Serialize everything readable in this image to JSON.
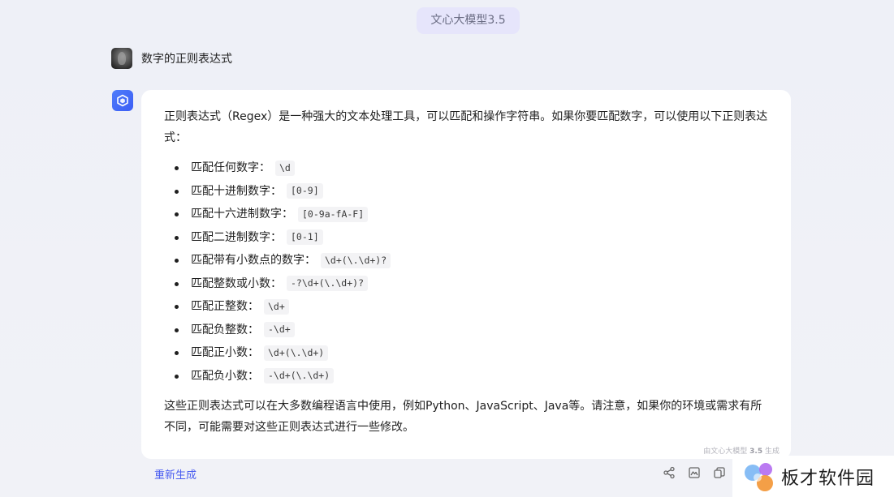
{
  "header": {
    "model_label": "文心大模型3.5"
  },
  "conversation": {
    "user_question": "数字的正则表达式",
    "answer": {
      "intro": "正则表达式（Regex）是一种强大的文本处理工具，可以匹配和操作字符串。如果你要匹配数字，可以使用以下正则表达式：",
      "items": [
        {
          "label": "匹配任何数字：",
          "code": "\\d"
        },
        {
          "label": "匹配十进制数字：",
          "code": "[0-9]"
        },
        {
          "label": "匹配十六进制数字：",
          "code": "[0-9a-fA-F]"
        },
        {
          "label": "匹配二进制数字：",
          "code": "[0-1]"
        },
        {
          "label": "匹配带有小数点的数字：",
          "code": "\\d+(\\.\\d+)?"
        },
        {
          "label": "匹配整数或小数：",
          "code": "-?\\d+(\\.\\d+)?"
        },
        {
          "label": "匹配正整数：",
          "code": "\\d+"
        },
        {
          "label": "匹配负整数：",
          "code": "-\\d+"
        },
        {
          "label": "匹配正小数：",
          "code": "\\d+(\\.\\d+)"
        },
        {
          "label": "匹配负小数：",
          "code": "-\\d+(\\.\\d+)"
        }
      ],
      "outro": "这些正则表达式可以在大多数编程语言中使用，例如Python、JavaScript、Java等。请注意，如果你的环境或需求有所不同，可能需要对这些正则表达式进行一些修改。",
      "generated_note_prefix": "由文心大模型 ",
      "generated_note_version": "3.5",
      "generated_note_suffix": " 生成"
    }
  },
  "actions": {
    "regenerate_label": "重新生成",
    "icons": [
      "share-icon",
      "image-icon",
      "copy-icon"
    ]
  },
  "watermark": {
    "text": "板才软件园"
  },
  "colors": {
    "accent": "#4a5df0",
    "badge_bg": "#e6e5fb",
    "card_bg": "#ffffff",
    "page_bg": "#eff0f6"
  }
}
